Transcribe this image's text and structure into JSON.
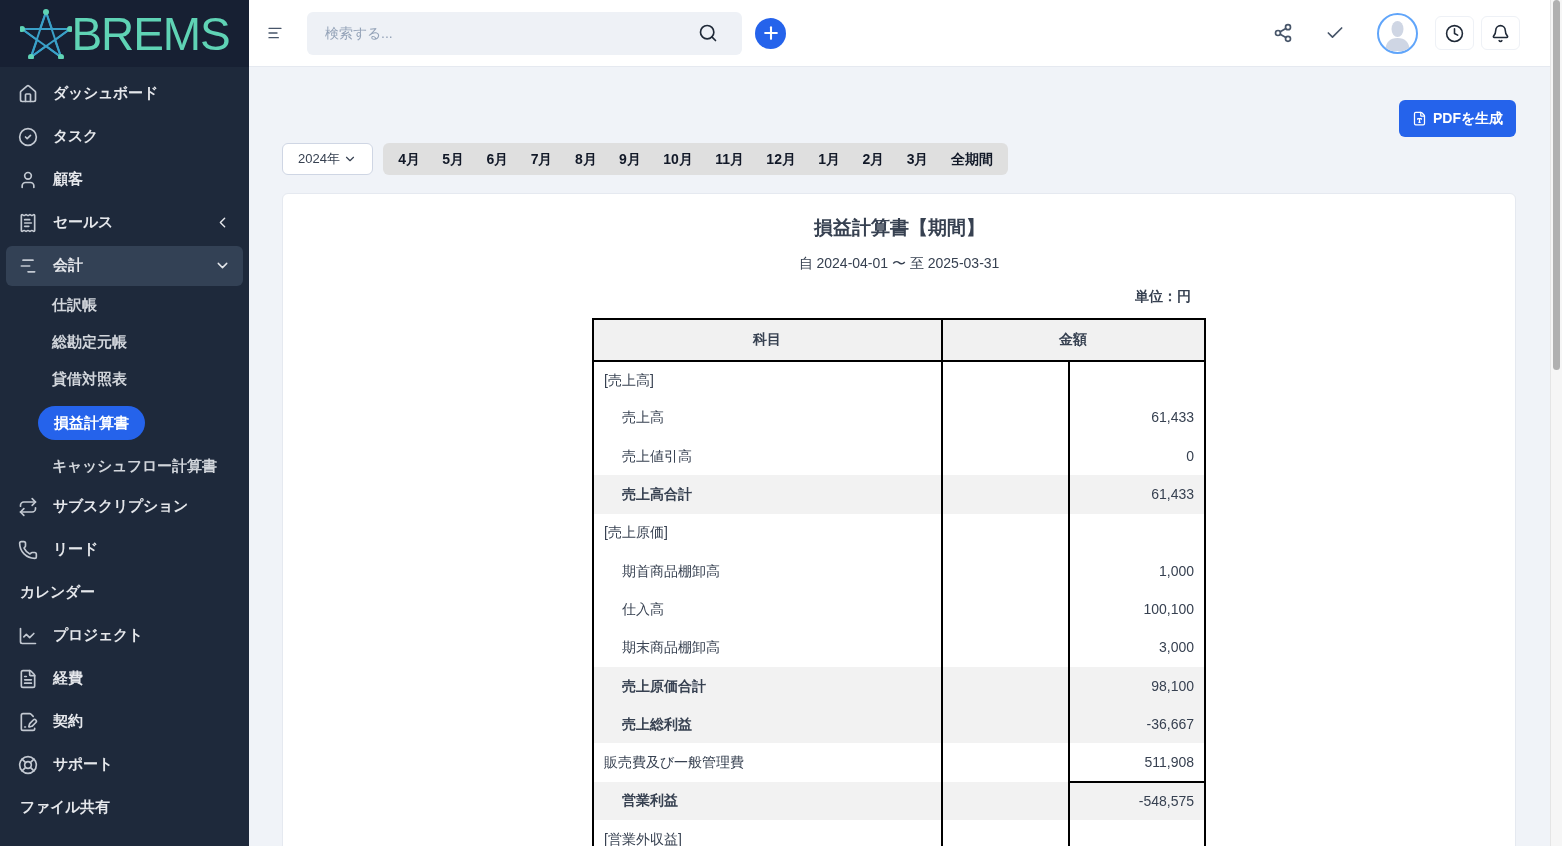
{
  "logo": {
    "text": "BREMS"
  },
  "sidebar": {
    "items": [
      {
        "label": "ダッシュボード",
        "kind": "link"
      },
      {
        "label": "タスク",
        "kind": "link"
      },
      {
        "label": "顧客",
        "kind": "link"
      },
      {
        "label": "セールス",
        "kind": "group",
        "expanded": false
      },
      {
        "label": "会計",
        "kind": "group",
        "expanded": true,
        "children": [
          {
            "label": "仕訳帳",
            "selected": false
          },
          {
            "label": "総勘定元帳",
            "selected": false
          },
          {
            "label": "貸借対照表",
            "selected": false
          },
          {
            "label": "損益計算書",
            "selected": true
          },
          {
            "label": "キャッシュフロー計算書",
            "selected": false
          }
        ]
      },
      {
        "label": "サブスクリプション",
        "kind": "link"
      },
      {
        "label": "リード",
        "kind": "link"
      },
      {
        "label": "カレンダー",
        "kind": "link"
      },
      {
        "label": "プロジェクト",
        "kind": "link"
      },
      {
        "label": "経費",
        "kind": "link"
      },
      {
        "label": "契約",
        "kind": "link"
      },
      {
        "label": "サポート",
        "kind": "link"
      },
      {
        "label": "ファイル共有",
        "kind": "link"
      }
    ]
  },
  "topbar": {
    "search": {
      "placeholder": "検索する..."
    }
  },
  "pdf_button": "PDFを生成",
  "year_select": "2024年",
  "months": [
    "4月",
    "5月",
    "6月",
    "7月",
    "8月",
    "9月",
    "10月",
    "11月",
    "12月",
    "1月",
    "2月",
    "3月",
    "全期間"
  ],
  "report": {
    "title": "損益計算書【期間】",
    "period": "自 2024-04-01 〜 至 2025-03-31",
    "unit": "単位：円",
    "columns": [
      "科目",
      "金額"
    ],
    "rows": [
      {
        "kind": "section",
        "label": "[売上高]",
        "amount": "",
        "ruled": false
      },
      {
        "kind": "item",
        "label": "売上高",
        "amount": "61,433",
        "ruled": false
      },
      {
        "kind": "item",
        "label": "売上値引高",
        "amount": "0",
        "ruled": false
      },
      {
        "kind": "subtotal",
        "label": "売上高合計",
        "amount": "61,433",
        "ruled": false
      },
      {
        "kind": "section",
        "label": "[売上原価]",
        "amount": "",
        "ruled": false
      },
      {
        "kind": "item",
        "label": "期首商品棚卸高",
        "amount": "1,000",
        "ruled": false
      },
      {
        "kind": "item",
        "label": "仕入高",
        "amount": "100,100",
        "ruled": false
      },
      {
        "kind": "item",
        "label": "期末商品棚卸高",
        "amount": "3,000",
        "ruled": false
      },
      {
        "kind": "subtotal",
        "label": "売上原価合計",
        "amount": "98,100",
        "ruled": false
      },
      {
        "kind": "subtotal",
        "label": "売上総利益",
        "amount": "-36,667",
        "ruled": false
      },
      {
        "kind": "section",
        "label": "販売費及び一般管理費",
        "amount": "511,908",
        "ruled": false
      },
      {
        "kind": "subtotal",
        "label": "営業利益",
        "amount": "-548,575",
        "ruled": true
      },
      {
        "kind": "section",
        "label": "[営業外収益]",
        "amount": "",
        "ruled": false
      }
    ]
  }
}
